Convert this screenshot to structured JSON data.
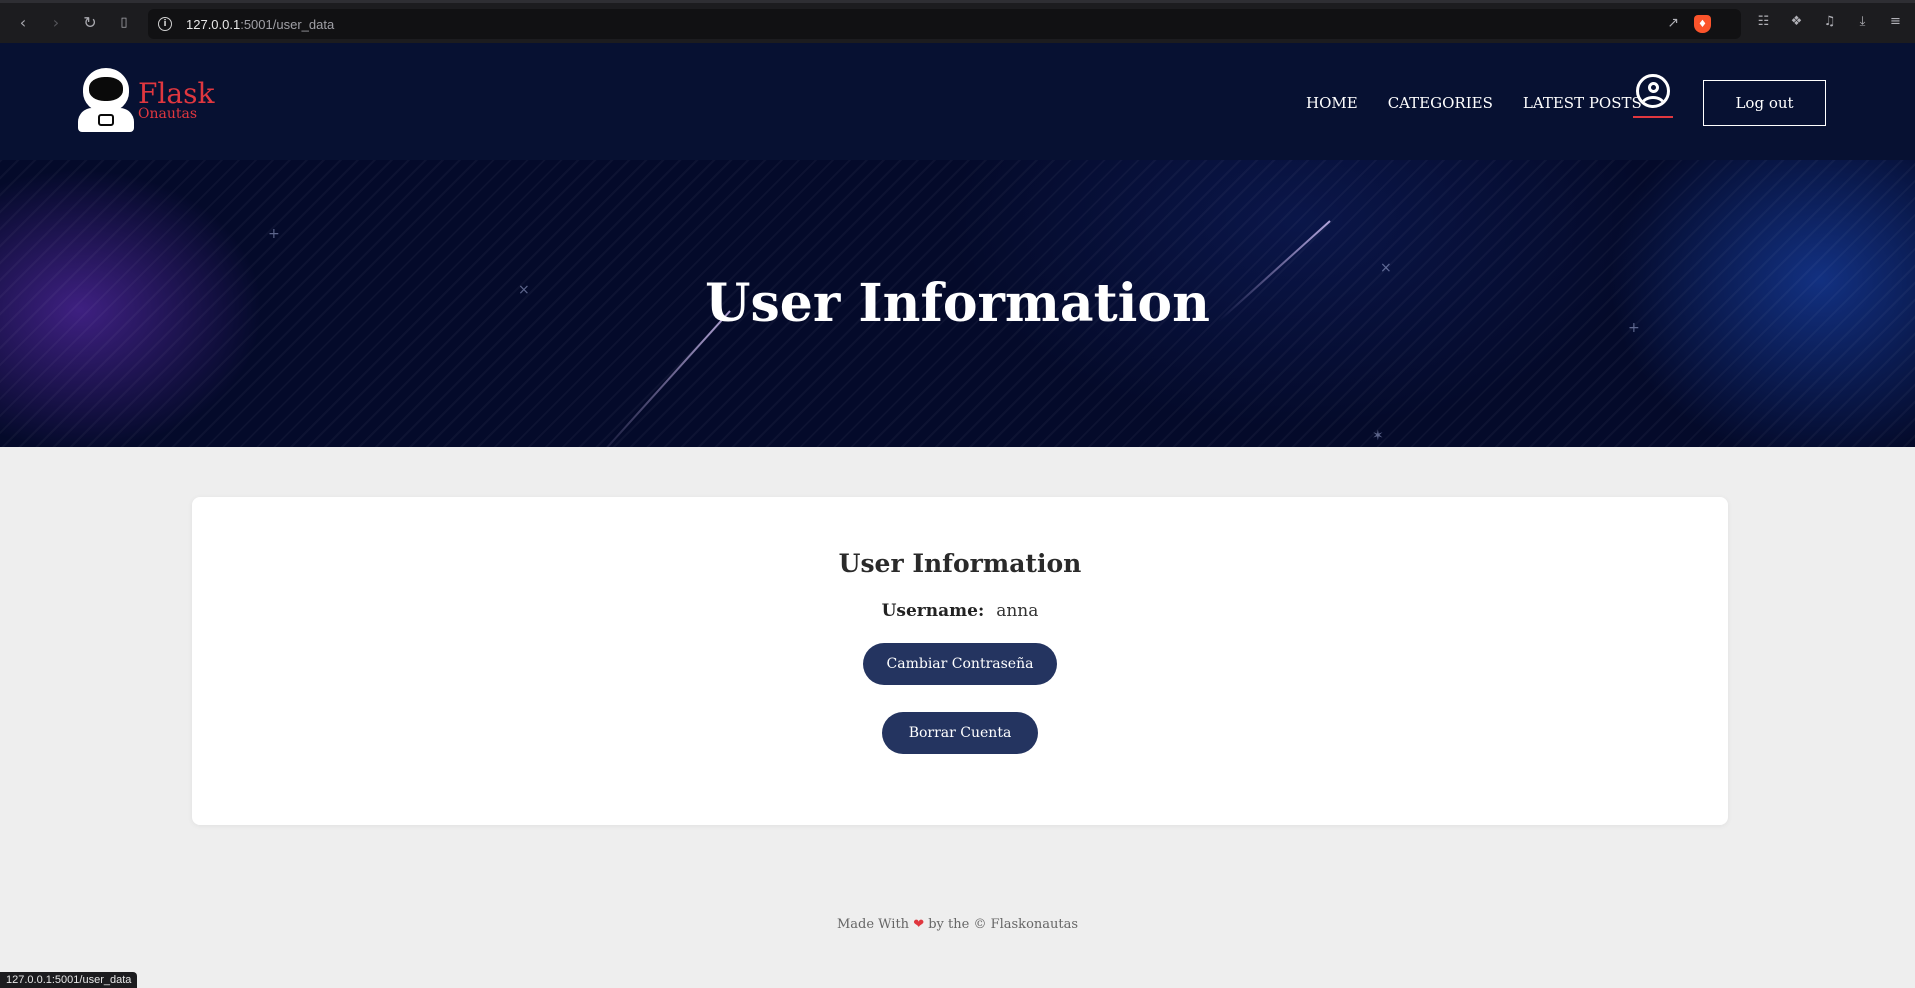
{
  "browser": {
    "url_host": "127.0.0.1",
    "url_path": ":5001/user_data",
    "status_url": "127.0.0.1:5001/user_data",
    "icons": [
      "back-icon",
      "forward-icon",
      "reload-icon",
      "bookmark-icon",
      "info-icon",
      "share-icon",
      "brave-shield-icon",
      "translate-icon",
      "extensions-icon",
      "media-icon",
      "downloads-icon",
      "menu-icon"
    ]
  },
  "header": {
    "logo_title": "Flask",
    "logo_sub": "Onautas",
    "nav": [
      "HOME",
      "CATEGORIES",
      "LATEST POSTS"
    ],
    "logout_label": "Log out",
    "accent_color": "#e0373f",
    "bg_color": "#071132"
  },
  "hero": {
    "title": "User Information"
  },
  "card": {
    "title": "User Information",
    "username_label": "Username:",
    "username_value": "anna",
    "change_password_label": "Cambiar Contraseña",
    "delete_account_label": "Borrar Cuenta",
    "button_color": "#243460"
  },
  "footer": {
    "made_with": "Made With",
    "by_text": "by the © Flaskonautas"
  }
}
